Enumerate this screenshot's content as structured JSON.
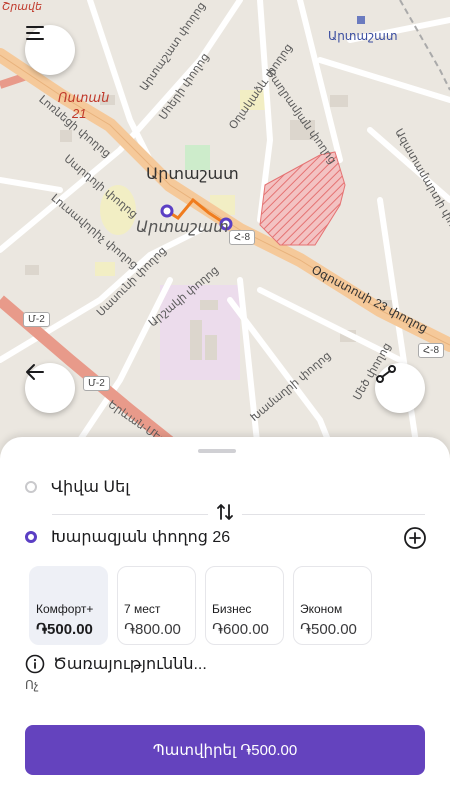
{
  "map": {
    "city_label": "Արտաշատ",
    "city_label_italic": "Արտաշատ",
    "region_label": "Արտաշատ",
    "red_label": "Ոստան",
    "red_number": "21",
    "red_label_top": "Շրավե",
    "street_labels": [
      "Արտաշատ փողոց",
      "Մհերի փողոց",
      "Օղակաձև փողոց",
      "Լոռնեցի փողոց",
      "Սարդոյի փողոց",
      "Բաղրամյան փողոց",
      "Լուսավորիչ փողոց",
      "Ազատամարտի փողոց",
      "Սասունի փողոց",
      "Արշակի փողոց",
      "Խամաղրի փողոց",
      "Մեծ փողոց",
      "Օգոստոսի 23 փողոց",
      "Երևան-Մեղրի"
    ],
    "shields": [
      "Հ-8",
      "Մ-2",
      "Մ-2",
      "Հ-8"
    ]
  },
  "buttons": {
    "menu": "menu-icon",
    "back": "back-arrow-icon",
    "route": "route-icon"
  },
  "route": {
    "from": "Վիվա Սել",
    "to": "Խարազյան փողոց 26"
  },
  "tariffs": [
    {
      "name": "Комфорт+",
      "price": "֏500.00",
      "selected": true
    },
    {
      "name": "7 мест",
      "price": "֏800.00",
      "selected": false
    },
    {
      "name": "Бизнес",
      "price": "֏600.00",
      "selected": false
    },
    {
      "name": "Эконом",
      "price": "֏500.00",
      "selected": false
    }
  ],
  "services": {
    "title": "Ծառայություննն...",
    "subtitle": "Ոչ"
  },
  "order": {
    "label": "Պատվիրել ֏500.00"
  },
  "colors": {
    "accent": "#6443be",
    "route_line": "#f07c1e",
    "map_bg": "#ebe7e0",
    "main_road": "#f5c99a",
    "trunk_road": "#e89a8a"
  }
}
